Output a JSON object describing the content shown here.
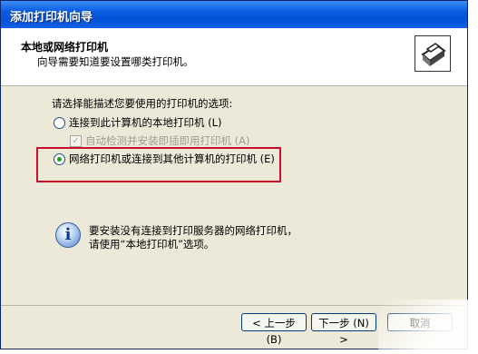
{
  "window": {
    "title": "添加打印机向导"
  },
  "header": {
    "title": "本地或网络打印机",
    "subtitle": "向导需要知道要设置哪类打印机。"
  },
  "content": {
    "prompt": "请选择能描述您要使用的打印机的选项:",
    "options": [
      {
        "label": "连接到此计算机的本地打印机 (L)",
        "selected": false
      },
      {
        "label": "自动检测并安装即插即用打印机 (A)",
        "checked": true,
        "disabled": true
      },
      {
        "label": "网络打印机或连接到其他计算机的打印机 (E)",
        "selected": true
      }
    ],
    "info_lines": [
      "要安装没有连接到打印服务器的网络打印机，",
      "请使用“本地打印机”选项。"
    ]
  },
  "buttons": {
    "back": "< 上一步 (B)",
    "next": "下一步 (N) >",
    "cancel": "取消"
  },
  "colors": {
    "title_bar": "#0453d6",
    "highlight_box": "#c8102e",
    "dialog_bg": "#ece9d8"
  }
}
